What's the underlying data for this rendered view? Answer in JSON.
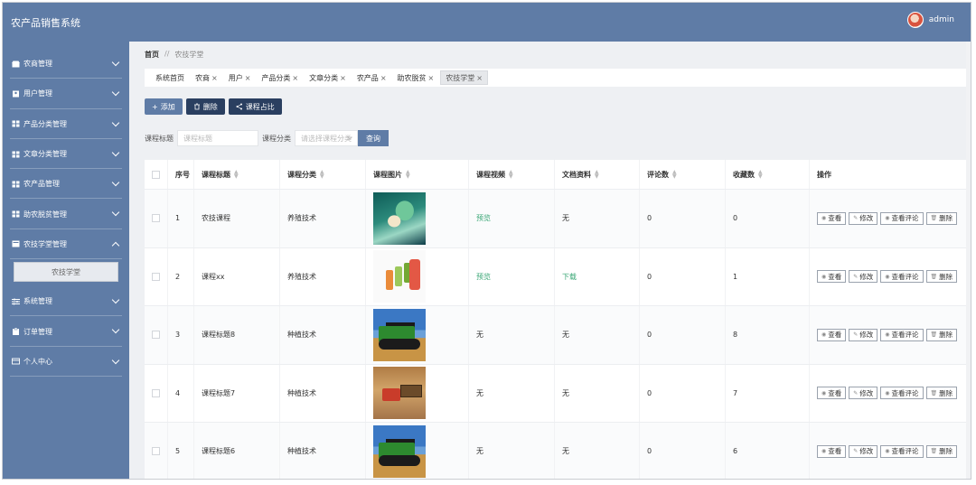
{
  "app": {
    "title": "农产品销售系统",
    "user": "admin"
  },
  "sidebar": {
    "items": [
      {
        "label": "农商管理",
        "icon": "store-icon",
        "expanded": false
      },
      {
        "label": "用户管理",
        "icon": "user-icon",
        "expanded": false
      },
      {
        "label": "产品分类管理",
        "icon": "grid-icon",
        "expanded": false
      },
      {
        "label": "文章分类管理",
        "icon": "grid-icon",
        "expanded": false
      },
      {
        "label": "农产品管理",
        "icon": "grid-icon",
        "expanded": false
      },
      {
        "label": "助农脱贫管理",
        "icon": "grid-icon",
        "expanded": false
      },
      {
        "label": "农技学堂管理",
        "icon": "book-icon",
        "expanded": true,
        "children": [
          "农技学堂"
        ]
      },
      {
        "label": "系统管理",
        "icon": "sliders-icon",
        "expanded": false
      },
      {
        "label": "订单管理",
        "icon": "clipboard-icon",
        "expanded": false
      },
      {
        "label": "个人中心",
        "icon": "card-icon",
        "expanded": false
      }
    ]
  },
  "breadcrumb": {
    "home": "首页",
    "sep": "//",
    "current": "农技学堂"
  },
  "tabs": [
    {
      "label": "系统首页",
      "closable": false,
      "active": false
    },
    {
      "label": "农商",
      "closable": true,
      "active": false
    },
    {
      "label": "用户",
      "closable": true,
      "active": false
    },
    {
      "label": "产品分类",
      "closable": true,
      "active": false
    },
    {
      "label": "文章分类",
      "closable": true,
      "active": false
    },
    {
      "label": "农产品",
      "closable": true,
      "active": false
    },
    {
      "label": "助农脱贫",
      "closable": true,
      "active": false
    },
    {
      "label": "农技学堂",
      "closable": true,
      "active": true
    }
  ],
  "toolbar": {
    "add": "添加",
    "delete": "删除",
    "ratio": "课程占比"
  },
  "search": {
    "title_label": "课程标题",
    "title_placeholder": "课程标题",
    "category_label": "课程分类",
    "category_placeholder": "请选择课程分类",
    "button": "查询"
  },
  "table": {
    "columns": [
      "序号",
      "课程标题",
      "课程分类",
      "课程图片",
      "课程视频",
      "文档资料",
      "评论数",
      "收藏数",
      "操作"
    ],
    "actions": {
      "view": "查看",
      "edit": "修改",
      "comments": "查看评论",
      "delete": "删除"
    },
    "rows": [
      {
        "no": "1",
        "title": "农技课程",
        "category": "养殖技术",
        "image": "ocean",
        "video": "预览",
        "video_link": true,
        "doc": "无",
        "doc_link": false,
        "comments": "0",
        "favorites": "0"
      },
      {
        "no": "2",
        "title": "课程xx",
        "category": "养殖技术",
        "image": "bottles",
        "video": "预览",
        "video_link": true,
        "doc": "下载",
        "doc_link": true,
        "comments": "0",
        "favorites": "1"
      },
      {
        "no": "3",
        "title": "课程标题8",
        "category": "种植技术",
        "image": "tractor",
        "video": "无",
        "video_link": false,
        "doc": "无",
        "doc_link": false,
        "comments": "0",
        "favorites": "8"
      },
      {
        "no": "4",
        "title": "课程标题7",
        "category": "种植技术",
        "image": "harvest",
        "video": "无",
        "video_link": false,
        "doc": "无",
        "doc_link": false,
        "comments": "0",
        "favorites": "7"
      },
      {
        "no": "5",
        "title": "课程标题6",
        "category": "种植技术",
        "image": "tractor",
        "video": "无",
        "video_link": false,
        "doc": "无",
        "doc_link": false,
        "comments": "0",
        "favorites": "6"
      }
    ]
  },
  "colors": {
    "primary": "#5f7ca6",
    "dark": "#2a3f60",
    "link": "#3aa776",
    "page_bg": "#eef0f3"
  }
}
